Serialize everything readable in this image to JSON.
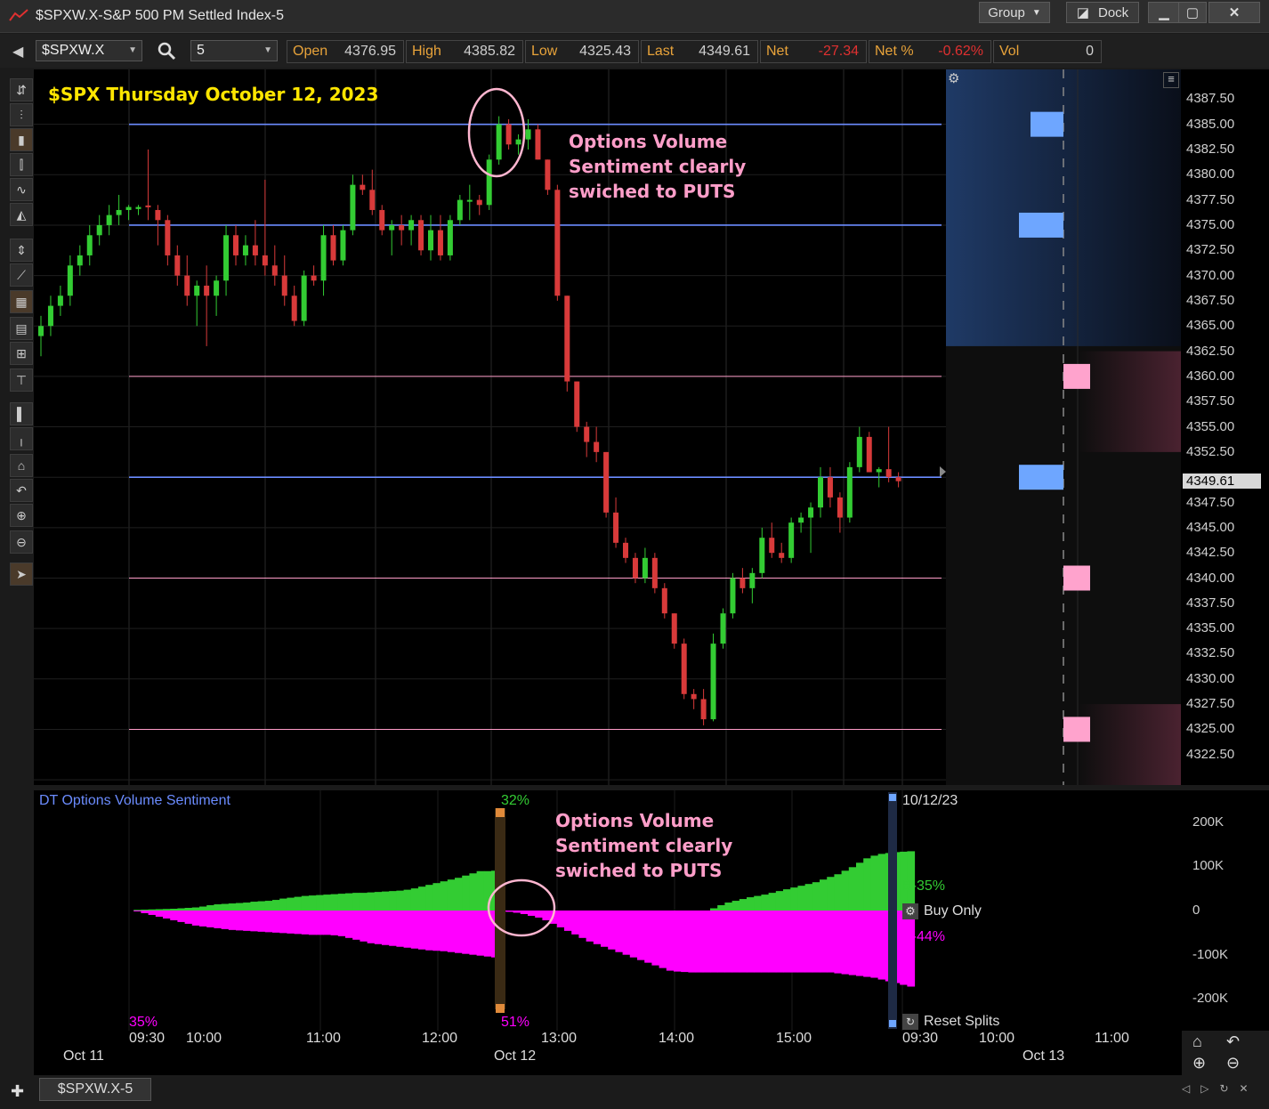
{
  "window": {
    "title": "$SPXW.X-S&P 500 PM Settled Index-5",
    "group_label": "Group",
    "dock_label": "Dock",
    "min_icon": "minimize-icon",
    "max_icon": "maximize-icon",
    "close_icon": "close-icon"
  },
  "toolbar": {
    "symbol": "$SPXW.X",
    "interval": "5",
    "quote": [
      {
        "label": "Open",
        "value": "4376.95",
        "color": "#cfcfcf"
      },
      {
        "label": "High",
        "value": "4385.82",
        "color": "#cfcfcf"
      },
      {
        "label": "Low",
        "value": "4325.43",
        "color": "#cfcfcf"
      },
      {
        "label": "Last",
        "value": "4349.61",
        "color": "#cfcfcf"
      },
      {
        "label": "Net",
        "value": "-27.34",
        "color": "#e03030"
      },
      {
        "label": "Net %",
        "value": "-0.62%",
        "color": "#e03030"
      },
      {
        "label": "Vol",
        "value": "0",
        "color": "#cfcfcf"
      }
    ]
  },
  "chart": {
    "heading": "$SPX Thursday October 12, 2023",
    "annotation_top": [
      "Options Volume",
      "Sentiment clearly",
      "swiched to PUTS"
    ],
    "annotation_bottom": [
      "Options Volume",
      "Sentiment clearly",
      "swiched to PUTS"
    ],
    "last_price_label": "4349.61",
    "price_ticks": [
      "4387.50",
      "4385.00",
      "4382.50",
      "4380.00",
      "4377.50",
      "4375.00",
      "4372.50",
      "4370.00",
      "4367.50",
      "4365.00",
      "4362.50",
      "4360.00",
      "4357.50",
      "4355.00",
      "4352.50",
      "4349.61",
      "4347.50",
      "4345.00",
      "4342.50",
      "4340.00",
      "4337.50",
      "4335.00",
      "4332.50",
      "4330.00",
      "4327.50",
      "4325.00",
      "4322.50"
    ]
  },
  "indicator": {
    "name": "DT Options Volume Sentiment",
    "date_label": "10/12/23",
    "top_pct": "32%",
    "bottom_left_pct": "35%",
    "bottom_mid_pct": "51%",
    "buy_label": "B-35%",
    "sell_label": "B-44%",
    "buy_only_label": "Buy Only",
    "reset_label": "Reset Splits",
    "axis_ticks": [
      "200K",
      "100K",
      "0",
      "-100K",
      "-200K"
    ]
  },
  "time_axis": {
    "times": [
      "09:30",
      "10:00",
      "11:00",
      "12:00",
      "13:00",
      "14:00",
      "15:00",
      "09:30",
      "10:00",
      "11:00"
    ],
    "dates": [
      "Oct 11",
      "Oct 12",
      "Oct 13"
    ]
  },
  "bottom_tab": "$SPXW.X-5",
  "colors": {
    "up": "#33cc33",
    "down": "#d83a3a",
    "buy_area": "#33cc33",
    "sell_area": "#ff00ff",
    "heading": "#ffe600",
    "annotation": "#ff9ec9",
    "blue_level": "#6b8cff",
    "pink_level": "#ff9ec9"
  },
  "chart_data": {
    "type": "candlestick",
    "title": "$SPX Thursday October 12, 2023",
    "interval_minutes": 5,
    "ylim": [
      4321,
      4390
    ],
    "horizontal_levels": [
      {
        "price": 4385.0,
        "color": "blue"
      },
      {
        "price": 4375.0,
        "color": "blue"
      },
      {
        "price": 4360.0,
        "color": "pink"
      },
      {
        "price": 4350.0,
        "color": "blue"
      },
      {
        "price": 4340.0,
        "color": "pink"
      },
      {
        "price": 4325.0,
        "color": "pink"
      }
    ],
    "candles": [
      {
        "t": "Oct 11 14:55",
        "o": 4364,
        "h": 4366,
        "l": 4362,
        "c": 4365
      },
      {
        "t": "Oct 11 15:00",
        "o": 4365,
        "h": 4368,
        "l": 4364,
        "c": 4367
      },
      {
        "t": "Oct 11 15:05",
        "o": 4367,
        "h": 4369,
        "l": 4366,
        "c": 4368
      },
      {
        "t": "Oct 11 15:10",
        "o": 4368,
        "h": 4372,
        "l": 4367,
        "c": 4371
      },
      {
        "t": "Oct 11 15:15",
        "o": 4371,
        "h": 4373,
        "l": 4370,
        "c": 4372
      },
      {
        "t": "Oct 11 15:20",
        "o": 4372,
        "h": 4375,
        "l": 4371,
        "c": 4374
      },
      {
        "t": "Oct 11 15:25",
        "o": 4374,
        "h": 4376,
        "l": 4373,
        "c": 4375
      },
      {
        "t": "Oct 11 15:30",
        "o": 4375,
        "h": 4377,
        "l": 4374,
        "c": 4376
      },
      {
        "t": "Oct 11 15:35",
        "o": 4376,
        "h": 4378,
        "l": 4375,
        "c": 4376.5
      },
      {
        "t": "Oct 11 15:40",
        "o": 4376.5,
        "h": 4377,
        "l": 4375.5,
        "c": 4376.8
      },
      {
        "t": "Oct 11 15:45",
        "o": 4376.6,
        "h": 4377,
        "l": 4376,
        "c": 4376.8
      },
      {
        "t": "Oct 12 09:30",
        "o": 4376.95,
        "h": 4382.5,
        "l": 4375.5,
        "c": 4376.9
      },
      {
        "t": "Oct 12 09:35",
        "o": 4376.5,
        "h": 4377,
        "l": 4373,
        "c": 4375.5
      },
      {
        "t": "Oct 12 09:40",
        "o": 4375.5,
        "h": 4376,
        "l": 4371,
        "c": 4372
      },
      {
        "t": "Oct 12 09:45",
        "o": 4372,
        "h": 4373,
        "l": 4369,
        "c": 4370
      },
      {
        "t": "Oct 12 09:50",
        "o": 4370,
        "h": 4372,
        "l": 4367,
        "c": 4368
      },
      {
        "t": "Oct 12 09:55",
        "o": 4368,
        "h": 4369.5,
        "l": 4365,
        "c": 4369
      },
      {
        "t": "Oct 12 10:00",
        "o": 4369,
        "h": 4371,
        "l": 4363,
        "c": 4368
      },
      {
        "t": "Oct 12 10:05",
        "o": 4368,
        "h": 4370,
        "l": 4366,
        "c": 4369.5
      },
      {
        "t": "Oct 12 10:10",
        "o": 4369.5,
        "h": 4375,
        "l": 4368,
        "c": 4374
      },
      {
        "t": "Oct 12 10:15",
        "o": 4374,
        "h": 4375,
        "l": 4371,
        "c": 4372
      },
      {
        "t": "Oct 12 10:20",
        "o": 4372,
        "h": 4374,
        "l": 4371,
        "c": 4373
      },
      {
        "t": "Oct 12 10:25",
        "o": 4373,
        "h": 4375.5,
        "l": 4371,
        "c": 4372
      },
      {
        "t": "Oct 12 10:30",
        "o": 4372,
        "h": 4379.5,
        "l": 4370,
        "c": 4371
      },
      {
        "t": "Oct 12 10:35",
        "o": 4371,
        "h": 4373,
        "l": 4369,
        "c": 4370
      },
      {
        "t": "Oct 12 10:40",
        "o": 4370,
        "h": 4372,
        "l": 4367,
        "c": 4368
      },
      {
        "t": "Oct 12 10:45",
        "o": 4368,
        "h": 4369,
        "l": 4365,
        "c": 4365.5
      },
      {
        "t": "Oct 12 10:50",
        "o": 4365.5,
        "h": 4370.5,
        "l": 4365,
        "c": 4370
      },
      {
        "t": "Oct 12 10:55",
        "o": 4370,
        "h": 4371,
        "l": 4369,
        "c": 4369.5
      },
      {
        "t": "Oct 12 11:00",
        "o": 4369.5,
        "h": 4375,
        "l": 4368,
        "c": 4374
      },
      {
        "t": "Oct 12 11:05",
        "o": 4374,
        "h": 4375,
        "l": 4371,
        "c": 4371.5
      },
      {
        "t": "Oct 12 11:10",
        "o": 4371.5,
        "h": 4375,
        "l": 4371,
        "c": 4374.5
      },
      {
        "t": "Oct 12 11:15",
        "o": 4374.5,
        "h": 4380,
        "l": 4374,
        "c": 4379
      },
      {
        "t": "Oct 12 11:20",
        "o": 4379,
        "h": 4380,
        "l": 4378,
        "c": 4378.5
      },
      {
        "t": "Oct 12 11:25",
        "o": 4378.5,
        "h": 4380.5,
        "l": 4376,
        "c": 4376.5
      },
      {
        "t": "Oct 12 11:30",
        "o": 4376.5,
        "h": 4377,
        "l": 4374,
        "c": 4374.5
      },
      {
        "t": "Oct 12 11:35",
        "o": 4374.5,
        "h": 4375.5,
        "l": 4372,
        "c": 4375
      },
      {
        "t": "Oct 12 11:40",
        "o": 4375,
        "h": 4376,
        "l": 4373,
        "c": 4374.5
      },
      {
        "t": "Oct 12 11:45",
        "o": 4374.5,
        "h": 4376,
        "l": 4373,
        "c": 4375.5
      },
      {
        "t": "Oct 12 11:50",
        "o": 4375.5,
        "h": 4376,
        "l": 4372,
        "c": 4372.5
      },
      {
        "t": "Oct 12 11:55",
        "o": 4372.5,
        "h": 4376,
        "l": 4371.5,
        "c": 4374.5
      },
      {
        "t": "Oct 12 12:00",
        "o": 4374.5,
        "h": 4376,
        "l": 4371.5,
        "c": 4372
      },
      {
        "t": "Oct 12 12:05",
        "o": 4372,
        "h": 4376,
        "l": 4371.5,
        "c": 4375.5
      },
      {
        "t": "Oct 12 12:10",
        "o": 4375.5,
        "h": 4378,
        "l": 4375,
        "c": 4377.5
      },
      {
        "t": "Oct 12 12:15",
        "o": 4377.5,
        "h": 4379,
        "l": 4375.5,
        "c": 4377.5
      },
      {
        "t": "Oct 12 12:20",
        "o": 4377.5,
        "h": 4378,
        "l": 4376,
        "c": 4377
      },
      {
        "t": "Oct 12 12:25",
        "o": 4377,
        "h": 4382,
        "l": 4376.5,
        "c": 4381.5
      },
      {
        "t": "Oct 12 12:30",
        "o": 4381.5,
        "h": 4385.8,
        "l": 4381,
        "c": 4385
      },
      {
        "t": "Oct 12 12:35",
        "o": 4385,
        "h": 4385.5,
        "l": 4382.5,
        "c": 4383
      },
      {
        "t": "Oct 12 12:40",
        "o": 4383,
        "h": 4384,
        "l": 4382,
        "c": 4383.5
      },
      {
        "t": "Oct 12 12:45",
        "o": 4383.5,
        "h": 4385.5,
        "l": 4382.5,
        "c": 4384.5
      },
      {
        "t": "Oct 12 12:50",
        "o": 4384.5,
        "h": 4385,
        "l": 4381.5,
        "c": 4381.5
      },
      {
        "t": "Oct 12 12:55",
        "o": 4381.5,
        "h": 4381.5,
        "l": 4378,
        "c": 4378.5
      },
      {
        "t": "Oct 12 13:00",
        "o": 4378.5,
        "h": 4379,
        "l": 4367.5,
        "c": 4368
      },
      {
        "t": "Oct 12 13:05",
        "o": 4368,
        "h": 4368,
        "l": 4358.5,
        "c": 4359.5
      },
      {
        "t": "Oct 12 13:10",
        "o": 4359.5,
        "h": 4359.5,
        "l": 4354.5,
        "c": 4355
      },
      {
        "t": "Oct 12 13:15",
        "o": 4355,
        "h": 4355.5,
        "l": 4352,
        "c": 4353.5
      },
      {
        "t": "Oct 12 13:20",
        "o": 4353.5,
        "h": 4355,
        "l": 4351.5,
        "c": 4352.5
      },
      {
        "t": "Oct 12 13:25",
        "o": 4352.5,
        "h": 4352.5,
        "l": 4346,
        "c": 4346.5
      },
      {
        "t": "Oct 12 13:30",
        "o": 4346.5,
        "h": 4348,
        "l": 4343,
        "c": 4343.5
      },
      {
        "t": "Oct 12 13:35",
        "o": 4343.5,
        "h": 4344,
        "l": 4341.5,
        "c": 4342
      },
      {
        "t": "Oct 12 13:40",
        "o": 4342,
        "h": 4342.5,
        "l": 4339.5,
        "c": 4340
      },
      {
        "t": "Oct 12 13:45",
        "o": 4340,
        "h": 4343,
        "l": 4339.5,
        "c": 4342
      },
      {
        "t": "Oct 12 13:50",
        "o": 4342,
        "h": 4342.5,
        "l": 4338.5,
        "c": 4339
      },
      {
        "t": "Oct 12 13:55",
        "o": 4339,
        "h": 4339.5,
        "l": 4336,
        "c": 4336.5
      },
      {
        "t": "Oct 12 14:00",
        "o": 4336.5,
        "h": 4336.5,
        "l": 4333,
        "c": 4333.5
      },
      {
        "t": "Oct 12 14:05",
        "o": 4333.5,
        "h": 4334,
        "l": 4328,
        "c": 4328.5
      },
      {
        "t": "Oct 12 14:10",
        "o": 4328.5,
        "h": 4329,
        "l": 4327,
        "c": 4328
      },
      {
        "t": "Oct 12 14:15",
        "o": 4328,
        "h": 4329,
        "l": 4325.4,
        "c": 4326
      },
      {
        "t": "Oct 12 14:20",
        "o": 4326,
        "h": 4334.5,
        "l": 4325.8,
        "c": 4333.5
      },
      {
        "t": "Oct 12 14:25",
        "o": 4333.5,
        "h": 4337,
        "l": 4333,
        "c": 4336.5
      },
      {
        "t": "Oct 12 14:30",
        "o": 4336.5,
        "h": 4340.5,
        "l": 4336,
        "c": 4340
      },
      {
        "t": "Oct 12 14:35",
        "o": 4340,
        "h": 4341,
        "l": 4338.5,
        "c": 4339
      },
      {
        "t": "Oct 12 14:40",
        "o": 4339,
        "h": 4341,
        "l": 4337.5,
        "c": 4340.5
      },
      {
        "t": "Oct 12 14:45",
        "o": 4340.5,
        "h": 4345,
        "l": 4340,
        "c": 4344
      },
      {
        "t": "Oct 12 14:50",
        "o": 4344,
        "h": 4345.5,
        "l": 4342,
        "c": 4342.5
      },
      {
        "t": "Oct 12 14:55",
        "o": 4342.5,
        "h": 4343.5,
        "l": 4341.5,
        "c": 4342
      },
      {
        "t": "Oct 12 15:00",
        "o": 4342,
        "h": 4346,
        "l": 4341.5,
        "c": 4345.5
      },
      {
        "t": "Oct 12 15:05",
        "o": 4345.5,
        "h": 4346.5,
        "l": 4344.5,
        "c": 4346
      },
      {
        "t": "Oct 12 15:10",
        "o": 4346,
        "h": 4347.5,
        "l": 4342.5,
        "c": 4347
      },
      {
        "t": "Oct 12 15:15",
        "o": 4347,
        "h": 4351,
        "l": 4346,
        "c": 4350
      },
      {
        "t": "Oct 12 15:20",
        "o": 4350,
        "h": 4351,
        "l": 4347,
        "c": 4348
      },
      {
        "t": "Oct 12 15:25",
        "o": 4348,
        "h": 4348.5,
        "l": 4344.5,
        "c": 4346
      },
      {
        "t": "Oct 12 15:30",
        "o": 4346,
        "h": 4351.5,
        "l": 4345.5,
        "c": 4351
      },
      {
        "t": "Oct 12 15:35",
        "o": 4351,
        "h": 4355,
        "l": 4350.5,
        "c": 4354
      },
      {
        "t": "Oct 12 15:40",
        "o": 4354,
        "h": 4354.5,
        "l": 4350.5,
        "c": 4350.5
      },
      {
        "t": "Oct 12 15:45",
        "o": 4350.5,
        "h": 4351,
        "l": 4349,
        "c": 4350.8
      },
      {
        "t": "Oct 12 15:50",
        "o": 4350.8,
        "h": 4355,
        "l": 4349.5,
        "c": 4350
      },
      {
        "t": "Oct 12 15:55",
        "o": 4350,
        "h": 4350.5,
        "l": 4349,
        "c": 4349.61
      }
    ],
    "profile_blocks": [
      {
        "price": 4385.0,
        "side": "buy"
      },
      {
        "price": 4375.0,
        "side": "buy"
      },
      {
        "price": 4360.0,
        "side": "sell"
      },
      {
        "price": 4350.0,
        "side": "buy"
      },
      {
        "price": 4340.0,
        "side": "sell"
      },
      {
        "price": 4325.0,
        "side": "sell"
      }
    ],
    "sentiment": {
      "ylim": [
        -230000,
        230000
      ],
      "ticks": [
        200000,
        100000,
        0,
        -100000,
        -200000
      ],
      "buy_cumulative": [
        0,
        1500,
        2000,
        2500,
        3000,
        3500,
        4000,
        5000,
        6000,
        7000,
        9000,
        12000,
        14000,
        15000,
        16000,
        17000,
        18000,
        20000,
        21000,
        22000,
        24000,
        27000,
        29000,
        31000,
        33000,
        34000,
        35000,
        36000,
        37000,
        38000,
        39000,
        40000,
        40000,
        41000,
        42000,
        43000,
        44000,
        45000,
        47000,
        50000,
        54000,
        58000,
        62000,
        66000,
        70000,
        74000,
        79000,
        84000,
        89000,
        89000,
        90000,
        0,
        0,
        0,
        0,
        0,
        0,
        0,
        0,
        0,
        0,
        0,
        0,
        0,
        0,
        0,
        0,
        0,
        0,
        0,
        0,
        0,
        0,
        0,
        0,
        0,
        0,
        0,
        0,
        0,
        5000,
        12000,
        18000,
        22000,
        26000,
        30000,
        33000,
        36000,
        40000,
        44000,
        48000,
        52000,
        56000,
        60000,
        64000,
        70000,
        76000,
        82000,
        90000,
        98000,
        108000,
        118000,
        124000,
        128000,
        130000,
        132000,
        133000,
        134000
      ],
      "sell_cumulative": [
        0,
        -2000,
        -6000,
        -10000,
        -14000,
        -18000,
        -22000,
        -26000,
        -30000,
        -34000,
        -36000,
        -38000,
        -40000,
        -42000,
        -44000,
        -45000,
        -46000,
        -47000,
        -48000,
        -49000,
        -50000,
        -51000,
        -52000,
        -53000,
        -54000,
        -55000,
        -55000,
        -55000,
        -56000,
        -58000,
        -62000,
        -66000,
        -70000,
        -74000,
        -76000,
        -78000,
        -80000,
        -82000,
        -84000,
        -86000,
        -88000,
        -90000,
        -91000,
        -92000,
        -94000,
        -96000,
        -98000,
        -100000,
        -102000,
        -104000,
        -106000,
        -2000,
        -3000,
        -5000,
        -8000,
        -12000,
        -16000,
        -22000,
        -30000,
        -38000,
        -46000,
        -54000,
        -62000,
        -70000,
        -76000,
        -82000,
        -88000,
        -94000,
        -100000,
        -106000,
        -112000,
        -118000,
        -124000,
        -130000,
        -136000,
        -138000,
        -139000,
        -140000,
        -140000,
        -140000,
        -140000,
        -140000,
        -140000,
        -140000,
        -140000,
        -140000,
        -140000,
        -140000,
        -140000,
        -140000,
        -140000,
        -140000,
        -140000,
        -140000,
        -140000,
        -140000,
        -140000,
        -142000,
        -144000,
        -146000,
        -148000,
        -150000,
        -152000,
        -156000,
        -160000,
        -164000,
        -168000,
        -172000
      ]
    }
  }
}
